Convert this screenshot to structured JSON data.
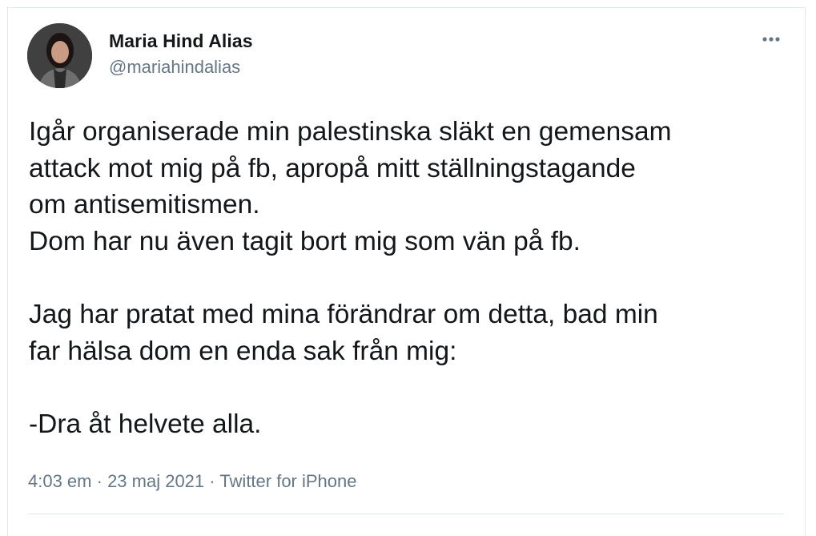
{
  "tweet": {
    "author": {
      "display_name": "Maria Hind Alias",
      "handle": "@mariahindalias"
    },
    "more_icon": "more-horizontal-icon",
    "text": "Igår organiserade min palestinska släkt en gemensam\nattack mot mig på fb, apropå mitt ställningstagande\nom antisemitismen.\nDom har nu även tagit bort mig som vän på fb.\n\nJag har pratat med mina förändrar om detta, bad min\nfar hälsa dom en enda sak från mig:\n\n-Dra åt helvete alla.",
    "meta": {
      "time": "4:03 em",
      "separator": " · ",
      "date": "23 maj 2021",
      "source": "Twitter for iPhone"
    }
  },
  "colors": {
    "text_primary": "#14171a",
    "text_secondary": "#657786",
    "border": "#e1e8ed"
  }
}
